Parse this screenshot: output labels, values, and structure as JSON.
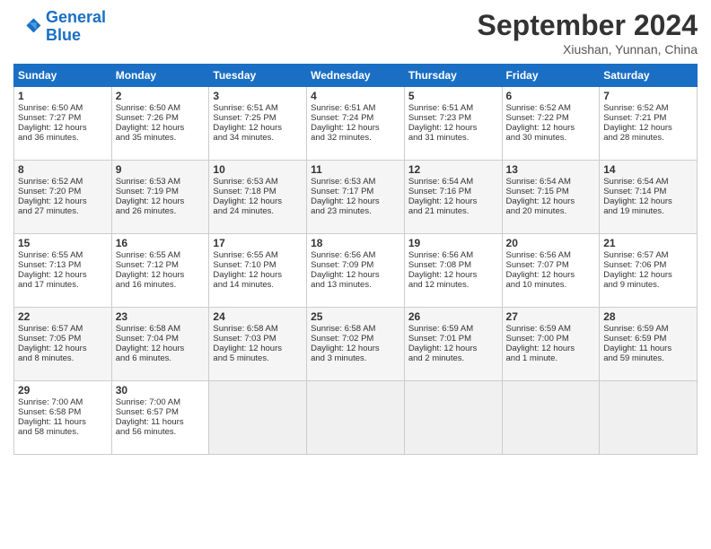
{
  "header": {
    "logo_line1": "General",
    "logo_line2": "Blue",
    "month": "September 2024",
    "location": "Xiushan, Yunnan, China"
  },
  "days_of_week": [
    "Sunday",
    "Monday",
    "Tuesday",
    "Wednesday",
    "Thursday",
    "Friday",
    "Saturday"
  ],
  "weeks": [
    [
      {
        "day": "1",
        "lines": [
          "Sunrise: 6:50 AM",
          "Sunset: 7:27 PM",
          "Daylight: 12 hours",
          "and 36 minutes."
        ]
      },
      {
        "day": "2",
        "lines": [
          "Sunrise: 6:50 AM",
          "Sunset: 7:26 PM",
          "Daylight: 12 hours",
          "and 35 minutes."
        ]
      },
      {
        "day": "3",
        "lines": [
          "Sunrise: 6:51 AM",
          "Sunset: 7:25 PM",
          "Daylight: 12 hours",
          "and 34 minutes."
        ]
      },
      {
        "day": "4",
        "lines": [
          "Sunrise: 6:51 AM",
          "Sunset: 7:24 PM",
          "Daylight: 12 hours",
          "and 32 minutes."
        ]
      },
      {
        "day": "5",
        "lines": [
          "Sunrise: 6:51 AM",
          "Sunset: 7:23 PM",
          "Daylight: 12 hours",
          "and 31 minutes."
        ]
      },
      {
        "day": "6",
        "lines": [
          "Sunrise: 6:52 AM",
          "Sunset: 7:22 PM",
          "Daylight: 12 hours",
          "and 30 minutes."
        ]
      },
      {
        "day": "7",
        "lines": [
          "Sunrise: 6:52 AM",
          "Sunset: 7:21 PM",
          "Daylight: 12 hours",
          "and 28 minutes."
        ]
      }
    ],
    [
      {
        "day": "8",
        "lines": [
          "Sunrise: 6:52 AM",
          "Sunset: 7:20 PM",
          "Daylight: 12 hours",
          "and 27 minutes."
        ]
      },
      {
        "day": "9",
        "lines": [
          "Sunrise: 6:53 AM",
          "Sunset: 7:19 PM",
          "Daylight: 12 hours",
          "and 26 minutes."
        ]
      },
      {
        "day": "10",
        "lines": [
          "Sunrise: 6:53 AM",
          "Sunset: 7:18 PM",
          "Daylight: 12 hours",
          "and 24 minutes."
        ]
      },
      {
        "day": "11",
        "lines": [
          "Sunrise: 6:53 AM",
          "Sunset: 7:17 PM",
          "Daylight: 12 hours",
          "and 23 minutes."
        ]
      },
      {
        "day": "12",
        "lines": [
          "Sunrise: 6:54 AM",
          "Sunset: 7:16 PM",
          "Daylight: 12 hours",
          "and 21 minutes."
        ]
      },
      {
        "day": "13",
        "lines": [
          "Sunrise: 6:54 AM",
          "Sunset: 7:15 PM",
          "Daylight: 12 hours",
          "and 20 minutes."
        ]
      },
      {
        "day": "14",
        "lines": [
          "Sunrise: 6:54 AM",
          "Sunset: 7:14 PM",
          "Daylight: 12 hours",
          "and 19 minutes."
        ]
      }
    ],
    [
      {
        "day": "15",
        "lines": [
          "Sunrise: 6:55 AM",
          "Sunset: 7:13 PM",
          "Daylight: 12 hours",
          "and 17 minutes."
        ]
      },
      {
        "day": "16",
        "lines": [
          "Sunrise: 6:55 AM",
          "Sunset: 7:12 PM",
          "Daylight: 12 hours",
          "and 16 minutes."
        ]
      },
      {
        "day": "17",
        "lines": [
          "Sunrise: 6:55 AM",
          "Sunset: 7:10 PM",
          "Daylight: 12 hours",
          "and 14 minutes."
        ]
      },
      {
        "day": "18",
        "lines": [
          "Sunrise: 6:56 AM",
          "Sunset: 7:09 PM",
          "Daylight: 12 hours",
          "and 13 minutes."
        ]
      },
      {
        "day": "19",
        "lines": [
          "Sunrise: 6:56 AM",
          "Sunset: 7:08 PM",
          "Daylight: 12 hours",
          "and 12 minutes."
        ]
      },
      {
        "day": "20",
        "lines": [
          "Sunrise: 6:56 AM",
          "Sunset: 7:07 PM",
          "Daylight: 12 hours",
          "and 10 minutes."
        ]
      },
      {
        "day": "21",
        "lines": [
          "Sunrise: 6:57 AM",
          "Sunset: 7:06 PM",
          "Daylight: 12 hours",
          "and 9 minutes."
        ]
      }
    ],
    [
      {
        "day": "22",
        "lines": [
          "Sunrise: 6:57 AM",
          "Sunset: 7:05 PM",
          "Daylight: 12 hours",
          "and 8 minutes."
        ]
      },
      {
        "day": "23",
        "lines": [
          "Sunrise: 6:58 AM",
          "Sunset: 7:04 PM",
          "Daylight: 12 hours",
          "and 6 minutes."
        ]
      },
      {
        "day": "24",
        "lines": [
          "Sunrise: 6:58 AM",
          "Sunset: 7:03 PM",
          "Daylight: 12 hours",
          "and 5 minutes."
        ]
      },
      {
        "day": "25",
        "lines": [
          "Sunrise: 6:58 AM",
          "Sunset: 7:02 PM",
          "Daylight: 12 hours",
          "and 3 minutes."
        ]
      },
      {
        "day": "26",
        "lines": [
          "Sunrise: 6:59 AM",
          "Sunset: 7:01 PM",
          "Daylight: 12 hours",
          "and 2 minutes."
        ]
      },
      {
        "day": "27",
        "lines": [
          "Sunrise: 6:59 AM",
          "Sunset: 7:00 PM",
          "Daylight: 12 hours",
          "and 1 minute."
        ]
      },
      {
        "day": "28",
        "lines": [
          "Sunrise: 6:59 AM",
          "Sunset: 6:59 PM",
          "Daylight: 11 hours",
          "and 59 minutes."
        ]
      }
    ],
    [
      {
        "day": "29",
        "lines": [
          "Sunrise: 7:00 AM",
          "Sunset: 6:58 PM",
          "Daylight: 11 hours",
          "and 58 minutes."
        ]
      },
      {
        "day": "30",
        "lines": [
          "Sunrise: 7:00 AM",
          "Sunset: 6:57 PM",
          "Daylight: 11 hours",
          "and 56 minutes."
        ]
      },
      {
        "day": "",
        "lines": []
      },
      {
        "day": "",
        "lines": []
      },
      {
        "day": "",
        "lines": []
      },
      {
        "day": "",
        "lines": []
      },
      {
        "day": "",
        "lines": []
      }
    ]
  ]
}
